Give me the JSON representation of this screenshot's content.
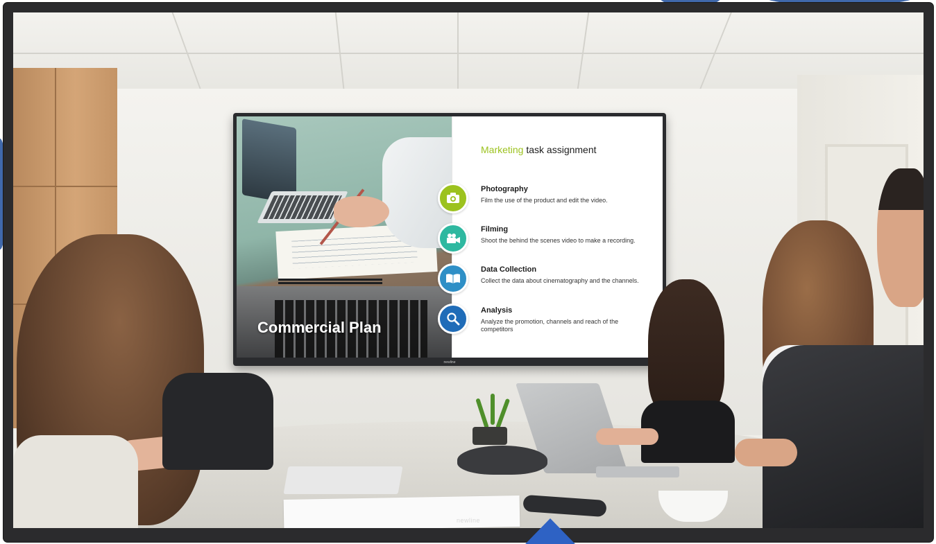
{
  "outer_display": {
    "brand": "newline"
  },
  "slide": {
    "photo_caption": "Commercial Plan",
    "heading_accent": "Marketing",
    "heading_rest": "task assignment",
    "items": [
      {
        "title": "Photography",
        "description": "Film the use of the product and edit the video.",
        "icon": "camera-icon",
        "color": "#9cc21e"
      },
      {
        "title": "Filming",
        "description": "Shoot the behind the scenes video to make a recording.",
        "icon": "video-camera-icon",
        "color": "#2eb8a0"
      },
      {
        "title": "Data Collection",
        "description": "Collect the data about cinematography and the channels.",
        "icon": "book-icon",
        "color": "#2e8fc6"
      },
      {
        "title": "Analysis",
        "description": "Analyze the promotion, channels and reach of the competitors",
        "icon": "magnifier-icon",
        "color": "#1f6cb8"
      }
    ]
  },
  "tv": {
    "brand": "newline"
  },
  "colors": {
    "bezel": "#2b2b2d",
    "accent_blue": "#2e62c4",
    "accent_green": "#9cc21e"
  }
}
